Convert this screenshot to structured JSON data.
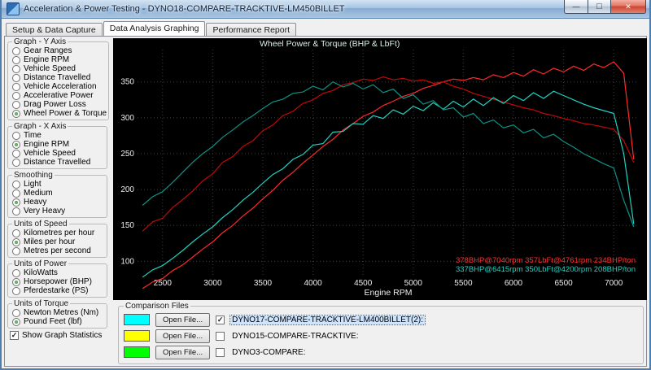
{
  "window": {
    "title": "Acceleration & Power Testing - DYNO18-COMPARE-TRACKTIVE-LM450BILLET"
  },
  "tabs": [
    {
      "label": "Setup & Data Capture",
      "active": false
    },
    {
      "label": "Data Analysis Graphing",
      "active": true
    },
    {
      "label": "Performance Report",
      "active": false
    }
  ],
  "sidebar": {
    "y_axis": {
      "title": "Graph - Y Axis",
      "options": [
        "Gear Ranges",
        "Engine RPM",
        "Vehicle Speed",
        "Distance Travelled",
        "Vehicle Acceleration",
        "Accelerative Power",
        "Drag Power Loss",
        "Wheel Power & Torque"
      ],
      "selected_index": 7
    },
    "x_axis": {
      "title": "Graph - X Axis",
      "options": [
        "Time",
        "Engine RPM",
        "Vehicle Speed",
        "Distance Travelled"
      ],
      "selected_index": 1
    },
    "smoothing": {
      "title": "Smoothing",
      "options": [
        "Light",
        "Medium",
        "Heavy",
        "Very Heavy"
      ],
      "selected_index": 2
    },
    "units_speed": {
      "title": "Units of Speed",
      "options": [
        "Kilometres per hour",
        "Miles per hour",
        "Metres per second"
      ],
      "selected_index": 1
    },
    "units_power": {
      "title": "Units of Power",
      "options": [
        "KiloWatts",
        "Horsepower (BHP)",
        "Pferdestarke (PS)"
      ],
      "selected_index": 1
    },
    "units_torque": {
      "title": "Units of Torque",
      "options": [
        "Newton Metres (Nm)",
        "Pound Feet (lbf)"
      ],
      "selected_index": 1
    },
    "show_stats": {
      "label": "Show Graph Statistics",
      "checked": true
    }
  },
  "comparison": {
    "title": "Comparison Files",
    "open_file_label": "Open File...",
    "files": [
      {
        "color": "#00ffff",
        "label": "DYNO17-COMPARE-TRACKTIVE-LM400BILLET(2):",
        "checked": true,
        "highlighted": true
      },
      {
        "color": "#ffff00",
        "label": "DYNO15-COMPARE-TRACKTIVE:",
        "checked": false,
        "highlighted": false
      },
      {
        "color": "#00ff00",
        "label": "DYNO3-COMPARE:",
        "checked": false,
        "highlighted": false
      }
    ]
  },
  "chart_data": {
    "type": "line",
    "title": "Wheel Power & Torque (BHP & LbFt)",
    "xlabel": "Engine RPM",
    "xlim": [
      2250,
      7250
    ],
    "ylim": [
      80,
      395
    ],
    "xticks": [
      2500,
      3000,
      3500,
      4000,
      4500,
      5000,
      5500,
      6000,
      6500,
      7000
    ],
    "yticks": [
      100,
      150,
      200,
      250,
      300,
      350
    ],
    "background": "#000000",
    "grid": true,
    "legend_position": "none",
    "x": [
      2300,
      2400,
      2500,
      2600,
      2700,
      2800,
      2900,
      3000,
      3100,
      3200,
      3300,
      3400,
      3500,
      3600,
      3700,
      3800,
      3900,
      4000,
      4100,
      4200,
      4300,
      4400,
      4500,
      4600,
      4700,
      4800,
      4900,
      5000,
      5100,
      5200,
      5300,
      5400,
      5500,
      5600,
      5700,
      5800,
      5900,
      6000,
      6100,
      6200,
      6300,
      6400,
      6500,
      6600,
      6700,
      6800,
      6900,
      7000,
      7100,
      7200
    ],
    "series": [
      {
        "name": "DYNO18 Wheel Power (BHP)",
        "color": "#ff2a2a",
        "values": [
          62,
          71,
          76,
          87,
          95,
          106,
          117,
          127,
          140,
          150,
          163,
          174,
          187,
          199,
          213,
          224,
          237,
          248,
          260,
          270,
          283,
          292,
          302,
          308,
          317,
          323,
          330,
          334,
          341,
          345,
          350,
          354,
          352,
          356,
          353,
          360,
          356,
          363,
          358,
          367,
          361,
          369,
          364,
          372,
          366,
          375,
          370,
          378,
          362,
          242
        ]
      },
      {
        "name": "DYNO18 Wheel Torque (LbFt)",
        "color": "#c40808",
        "values": [
          142,
          155,
          160,
          175,
          186,
          198,
          212,
          222,
          238,
          246,
          260,
          268,
          282,
          290,
          303,
          309,
          320,
          325,
          334,
          338,
          346,
          349,
          354,
          352,
          357,
          353,
          355,
          351,
          353,
          348,
          350,
          344,
          340,
          334,
          330,
          326,
          322,
          318,
          314,
          311,
          306,
          303,
          299,
          296,
          292,
          290,
          287,
          284,
          268,
          238
        ]
      },
      {
        "name": "DYNO17 Wheel Power (BHP)",
        "color": "#1fd2c2",
        "values": [
          78,
          88,
          94,
          104,
          115,
          127,
          138,
          148,
          161,
          172,
          185,
          196,
          209,
          221,
          229,
          242,
          249,
          262,
          264,
          280,
          281,
          292,
          291,
          303,
          299,
          311,
          305,
          316,
          310,
          321,
          312,
          323,
          315,
          326,
          317,
          328,
          320,
          331,
          324,
          335,
          327,
          337,
          331,
          325,
          319,
          314,
          310,
          306,
          250,
          152
        ]
      },
      {
        "name": "DYNO17 Wheel Torque (LbFt)",
        "color": "#0e9185",
        "values": [
          178,
          190,
          197,
          210,
          224,
          238,
          250,
          260,
          273,
          283,
          294,
          303,
          313,
          322,
          326,
          334,
          336,
          344,
          339,
          350,
          343,
          348,
          340,
          346,
          335,
          340,
          327,
          332,
          319,
          324,
          311,
          314,
          301,
          306,
          292,
          297,
          286,
          290,
          279,
          284,
          272,
          277,
          267,
          259,
          250,
          243,
          236,
          230,
          185,
          148
        ]
      }
    ],
    "stats": [
      {
        "text": "378BHP@7040rpm 357LbFt@4761rpm 234BHP/ton",
        "color": "#ff3030"
      },
      {
        "text": "337BHP@6415rpm 350LbFt@4200rpm 208BHP/ton",
        "color": "#1fd2c2"
      }
    ]
  }
}
